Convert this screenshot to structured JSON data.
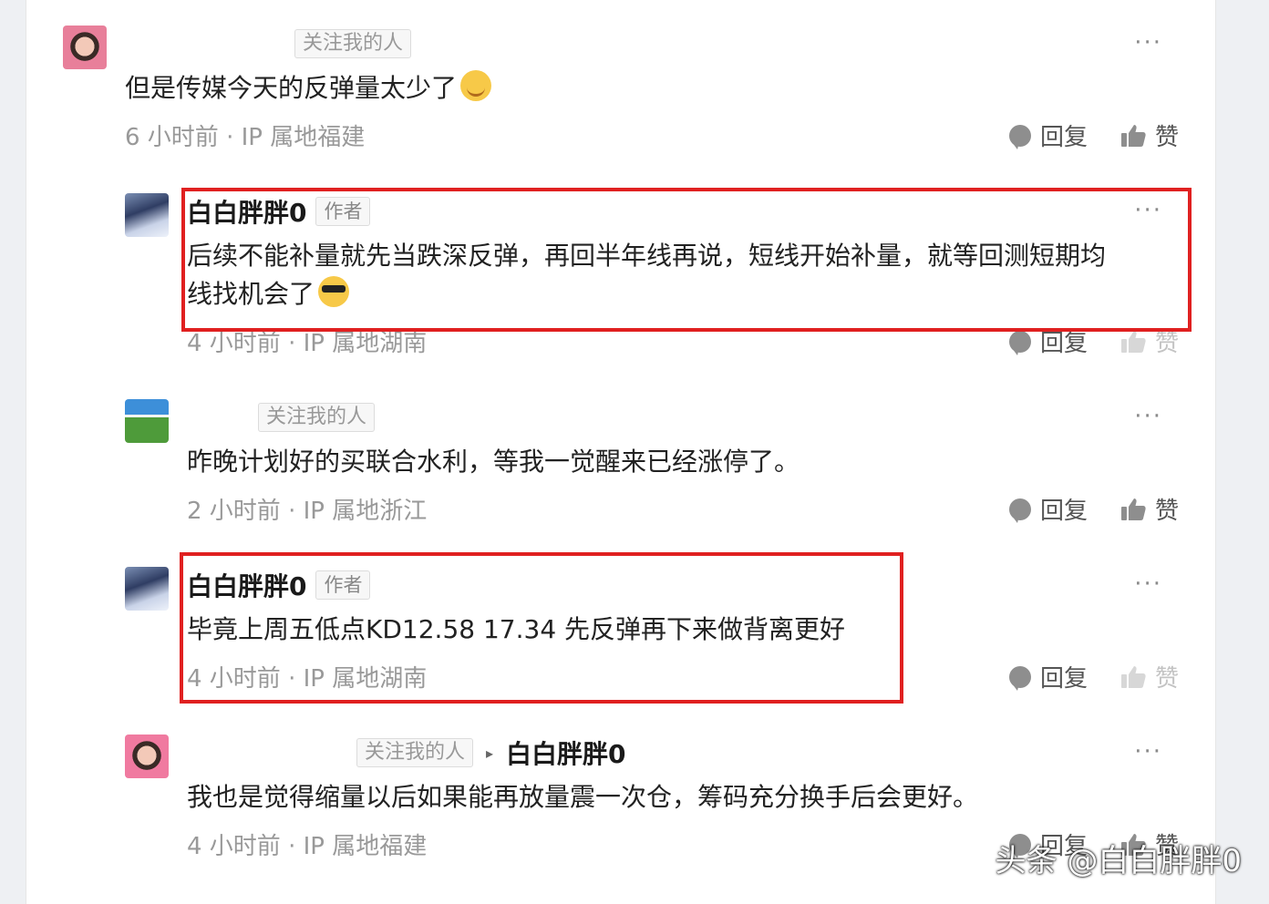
{
  "comments": [
    {
      "follow_badge": "关注我的人",
      "text": "但是传媒今天的反弹量太少了",
      "meta": "6 小时前 · IP 属地福建",
      "reply": "回复",
      "like": "赞",
      "more": "···"
    },
    {
      "author": "白白胖胖0",
      "author_badge": "作者",
      "text_line1": "后续不能补量就先当跌深反弹，再回半年线再说，短线开始补量，就等回测短期均",
      "text_line2": "线找机会了",
      "meta": "4 小时前 · IP 属地湖南",
      "reply": "回复",
      "like": "赞",
      "more": "···"
    },
    {
      "follow_badge": "关注我的人",
      "text": "昨晚计划好的买联合水利，等我一觉醒来已经涨停了。",
      "meta": "2 小时前 · IP 属地浙江",
      "reply": "回复",
      "like": "赞",
      "more": "···"
    },
    {
      "author": "白白胖胖0",
      "author_badge": "作者",
      "text": "毕竟上周五低点KD12.58 17.34 先反弹再下来做背离更好",
      "meta": "4 小时前 · IP 属地湖南",
      "reply": "回复",
      "like": "赞",
      "more": "···"
    },
    {
      "follow_badge": "关注我的人",
      "reply_to": "白白胖胖0",
      "text": "我也是觉得缩量以后如果能再放量震一次仓，筹码充分换手后会更好。",
      "meta": "4 小时前 · IP 属地福建",
      "reply": "回复",
      "like": "赞",
      "more": "···"
    }
  ],
  "watermark": "头条 @白白胖胖0",
  "colors": {
    "highlight_border": "#e02020",
    "background": "#ffffff"
  }
}
